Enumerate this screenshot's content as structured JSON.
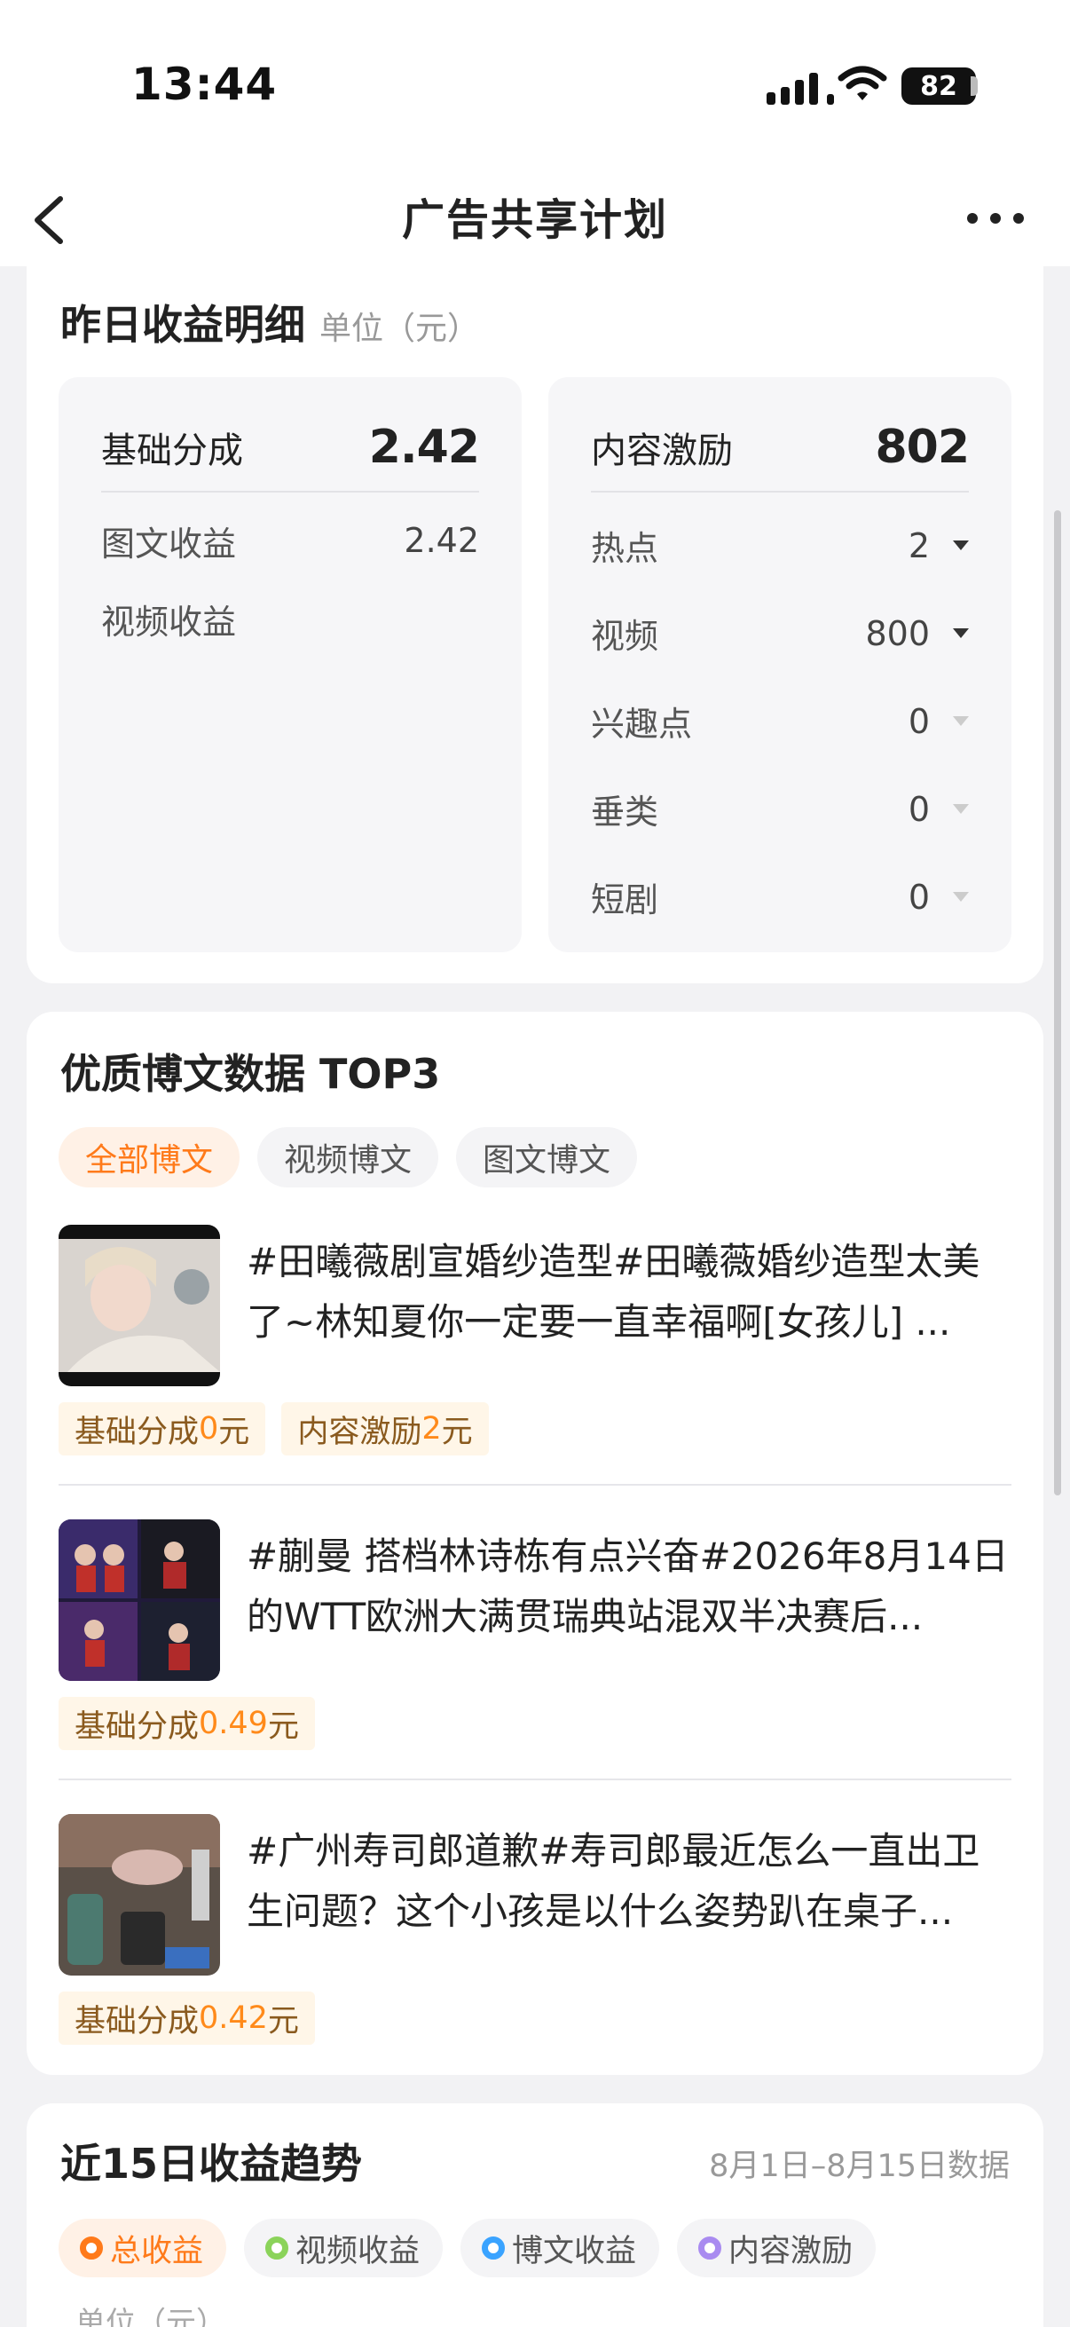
{
  "status_bar": {
    "time": "13:44",
    "battery": "82"
  },
  "nav": {
    "title": "广告共享计划"
  },
  "yesterday": {
    "title": "昨日收益明细",
    "unit": "单位（元）",
    "base": {
      "label": "基础分成",
      "value": "2.42",
      "rows": [
        {
          "label": "图文收益",
          "value": "2.42"
        },
        {
          "label": "视频收益",
          "value": ""
        }
      ]
    },
    "incentive": {
      "label": "内容激励",
      "value": "802",
      "rows": [
        {
          "label": "热点",
          "value": "2"
        },
        {
          "label": "视频",
          "value": "800"
        },
        {
          "label": "兴趣点",
          "value": "0"
        },
        {
          "label": "垂类",
          "value": "0"
        },
        {
          "label": "短剧",
          "value": "0"
        }
      ]
    }
  },
  "top3": {
    "title": "优质博文数据 TOP3",
    "filters": [
      "全部博文",
      "视频博文",
      "图文博文"
    ],
    "articles": [
      {
        "text": "#田曦薇剧宣婚纱造型#田曦薇婚纱造型太美了~林知夏你一定要一直幸福啊[女孩儿] ...",
        "tags": [
          {
            "prefix": "基础分成",
            "amount": "0",
            "suffix": "元"
          },
          {
            "prefix": "内容激励",
            "amount": "2",
            "suffix": "元"
          }
        ]
      },
      {
        "text": "#蒯曼 搭档林诗栋有点兴奋#2026年8月14日的WTT欧洲大满贯瑞典站混双半决赛后...",
        "tags": [
          {
            "prefix": "基础分成",
            "amount": "0.49",
            "suffix": "元"
          }
        ]
      },
      {
        "text": "#广州寿司郎道歉#寿司郎最近怎么一直出卫生问题？这个小孩是以什么姿势趴在桌子...",
        "tags": [
          {
            "prefix": "基础分成",
            "amount": "0.42",
            "suffix": "元"
          }
        ]
      }
    ]
  },
  "trend": {
    "title": "近15日收益趋势",
    "date_range": "8月1日–8月15日数据",
    "legend": [
      {
        "label": "总收益",
        "color": "#ff7a1a"
      },
      {
        "label": "视频收益",
        "color": "#8bd35a"
      },
      {
        "label": "博文收益",
        "color": "#3aa3ff"
      },
      {
        "label": "内容激励",
        "color": "#a98bf0"
      }
    ],
    "unit": "单位（元）"
  }
}
